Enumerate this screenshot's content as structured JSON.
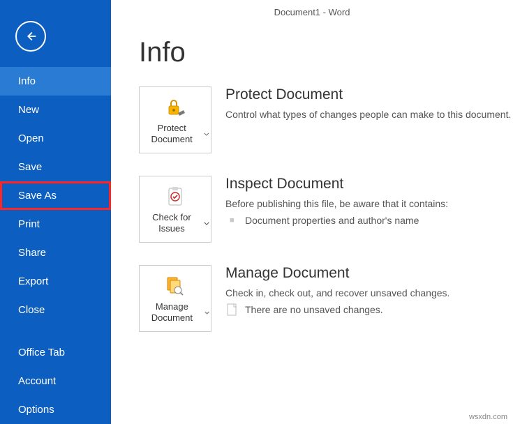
{
  "window_title": "Document1 - Word",
  "page_heading": "Info",
  "sidebar": {
    "items": [
      {
        "label": "Info",
        "active": true
      },
      {
        "label": "New"
      },
      {
        "label": "Open"
      },
      {
        "label": "Save"
      },
      {
        "label": "Save As",
        "highlight": true
      },
      {
        "label": "Print"
      },
      {
        "label": "Share"
      },
      {
        "label": "Export"
      },
      {
        "label": "Close"
      }
    ],
    "secondary": [
      {
        "label": "Office Tab"
      },
      {
        "label": "Account"
      },
      {
        "label": "Options"
      }
    ]
  },
  "cards": {
    "protect": {
      "tile_label": "Protect Document",
      "title": "Protect Document",
      "desc": "Control what types of changes people can make to this document."
    },
    "inspect": {
      "tile_label": "Check for Issues",
      "title": "Inspect Document",
      "desc": "Before publishing this file, be aware that it contains:",
      "item1": "Document properties and author's name"
    },
    "manage": {
      "tile_label": "Manage Document",
      "title": "Manage Document",
      "desc": "Check in, check out, and recover unsaved changes.",
      "item1": "There are no unsaved changes."
    }
  },
  "watermark": "wsxdn.com"
}
